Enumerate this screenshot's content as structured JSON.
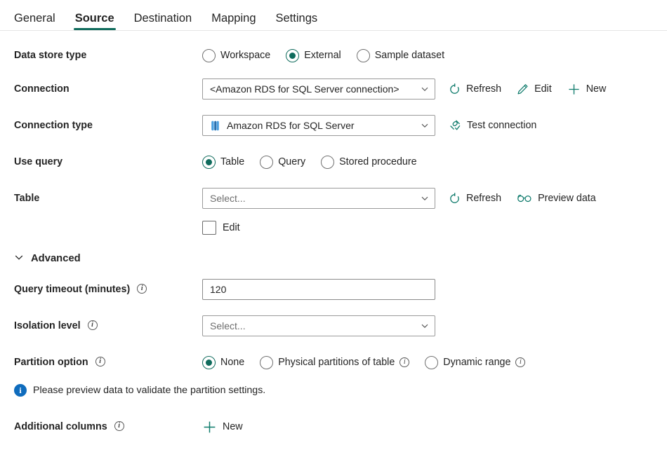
{
  "tabs": [
    {
      "label": "General",
      "active": false
    },
    {
      "label": "Source",
      "active": true
    },
    {
      "label": "Destination",
      "active": false
    },
    {
      "label": "Mapping",
      "active": false
    },
    {
      "label": "Settings",
      "active": false
    }
  ],
  "accent_color": "#0f6b5c",
  "icon_color": "#0f7b6c",
  "info_color": "#0f6cbd",
  "data_store_type": {
    "label": "Data store type",
    "options": [
      {
        "label": "Workspace",
        "selected": false
      },
      {
        "label": "External",
        "selected": true
      },
      {
        "label": "Sample dataset",
        "selected": false
      }
    ]
  },
  "connection": {
    "label": "Connection",
    "value": "<Amazon RDS for SQL Server connection>",
    "commands": [
      {
        "label": "Refresh",
        "icon": "refresh-icon"
      },
      {
        "label": "Edit",
        "icon": "pencil-icon"
      },
      {
        "label": "New",
        "icon": "plus-icon"
      }
    ]
  },
  "connection_type": {
    "label": "Connection type",
    "value": "Amazon RDS for SQL Server",
    "icon": "database-icon",
    "commands": [
      {
        "label": "Test connection",
        "icon": "plug-check-icon"
      }
    ]
  },
  "use_query": {
    "label": "Use query",
    "options": [
      {
        "label": "Table",
        "selected": true
      },
      {
        "label": "Query",
        "selected": false
      },
      {
        "label": "Stored procedure",
        "selected": false
      }
    ]
  },
  "table": {
    "label": "Table",
    "placeholder": "Select...",
    "value": "",
    "commands": [
      {
        "label": "Refresh",
        "icon": "refresh-icon"
      },
      {
        "label": "Preview data",
        "icon": "glasses-icon"
      }
    ],
    "edit_checkbox": {
      "label": "Edit",
      "checked": false
    }
  },
  "advanced": {
    "label": "Advanced",
    "expanded": true
  },
  "query_timeout": {
    "label": "Query timeout (minutes)",
    "has_info": true,
    "value": "120"
  },
  "isolation_level": {
    "label": "Isolation level",
    "has_info": true,
    "placeholder": "Select...",
    "value": ""
  },
  "partition_option": {
    "label": "Partition option",
    "has_info": true,
    "options": [
      {
        "label": "None",
        "selected": true,
        "has_info": false
      },
      {
        "label": "Physical partitions of table",
        "selected": false,
        "has_info": true
      },
      {
        "label": "Dynamic range",
        "selected": false,
        "has_info": true
      }
    ]
  },
  "message": {
    "icon": "info-icon",
    "text": "Please preview data to validate the partition settings."
  },
  "additional_columns": {
    "label": "Additional columns",
    "has_info": true,
    "commands": [
      {
        "label": "New",
        "icon": "plus-icon"
      }
    ]
  }
}
